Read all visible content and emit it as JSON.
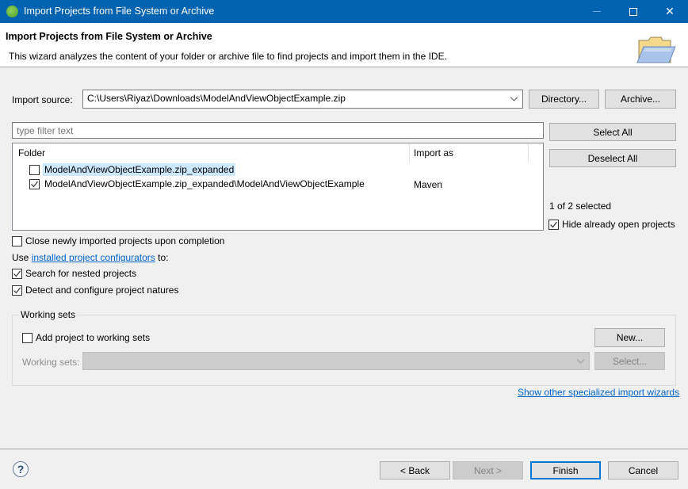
{
  "window": {
    "title": "Import Projects from File System or Archive",
    "minimize_icon": "minimize-icon",
    "maximize_icon": "maximize-icon",
    "close_icon": "close-icon",
    "close_glyph": "✕"
  },
  "header": {
    "title": "Import Projects from File System or Archive",
    "description": "This wizard analyzes the content of your folder or archive file to find projects and import them in the IDE.",
    "icon": "open-folder-icon"
  },
  "import_source": {
    "label": "Import source:",
    "value": "C:\\Users\\Riyaz\\Downloads\\ModelAndViewObjectExample.zip",
    "directory_button": "Directory...",
    "archive_button": "Archive..."
  },
  "filter": {
    "placeholder": "type filter text"
  },
  "table": {
    "columns": [
      "Folder",
      "Import as"
    ],
    "rows": [
      {
        "folder": "ModelAndViewObjectExample.zip_expanded",
        "import_as": "",
        "checked": false,
        "highlighted": true
      },
      {
        "folder": "ModelAndViewObjectExample.zip_expanded\\ModelAndViewObjectExample",
        "import_as": "Maven",
        "checked": true,
        "highlighted": false
      }
    ]
  },
  "side": {
    "select_all": "Select All",
    "deselect_all": "Deselect All",
    "selection_count": "1 of 2 selected",
    "hide_open_projects": {
      "label": "Hide already open projects",
      "checked": true
    }
  },
  "options": {
    "close_newly_imported": {
      "label": "Close newly imported projects upon completion",
      "checked": false
    },
    "use_prefix": "Use ",
    "configurators_link": "installed project configurators",
    "use_suffix": " to:",
    "search_nested": {
      "label": "Search for nested projects",
      "checked": true
    },
    "detect_natures": {
      "label": "Detect and configure project natures",
      "checked": true
    }
  },
  "working_sets": {
    "group_label": "Working sets",
    "add_to_sets": {
      "label": "Add project to working sets",
      "checked": false
    },
    "new_button": "New...",
    "sets_label": "Working sets:",
    "sets_value": "",
    "select_button": "Select..."
  },
  "show_other_wizards_link": "Show other specialized import wizards",
  "footer": {
    "help_glyph": "?",
    "back": "< Back",
    "next": "Next >",
    "finish": "Finish",
    "cancel": "Cancel"
  }
}
